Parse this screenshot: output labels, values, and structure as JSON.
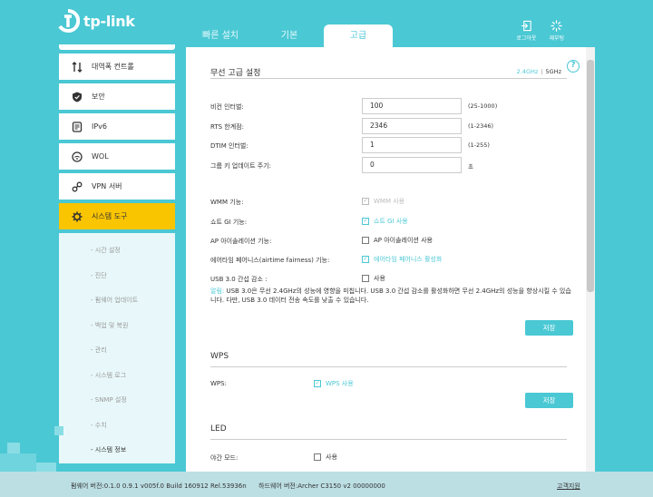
{
  "brand": {
    "name": "tp-link"
  },
  "tabs": [
    {
      "label": "빠른 설치"
    },
    {
      "label": "기본"
    },
    {
      "label": "고급"
    }
  ],
  "top_actions": {
    "logout": "로그아웃",
    "reboot": "재부팅"
  },
  "sidebar": {
    "items": [
      {
        "label": "대역폭 컨트롤",
        "icon": "bandwidth-icon"
      },
      {
        "label": "보안",
        "icon": "shield-icon"
      },
      {
        "label": "IPv6",
        "icon": "ipv6-icon"
      },
      {
        "label": "WOL",
        "icon": "wol-icon"
      },
      {
        "label": "VPN 서버",
        "icon": "vpn-icon"
      },
      {
        "label": "시스템 도구",
        "icon": "gear-icon"
      }
    ],
    "sub_items": [
      {
        "label": "- 시간 설정"
      },
      {
        "label": "- 진단"
      },
      {
        "label": "- 펌웨어 업데이트"
      },
      {
        "label": "- 백업 및 복원"
      },
      {
        "label": "- 관리"
      },
      {
        "label": "- 시스템 로그"
      },
      {
        "label": "- SNMP 설정"
      },
      {
        "label": "- 수치"
      },
      {
        "label": "- 시스템 정보"
      }
    ]
  },
  "wireless": {
    "title": "무선 고급 설정",
    "band_24": "2.4GHz",
    "band_5": "5GHz",
    "beacon": {
      "label": "비컨 인터벌:",
      "value": "100",
      "range": "(25-1000)"
    },
    "rts": {
      "label": "RTS 한계점:",
      "value": "2346",
      "range": "(1-2346)"
    },
    "dtim": {
      "label": "DTIM 인터벌:",
      "value": "1",
      "range": "(1-255)"
    },
    "group_key": {
      "label": "그룹 키 업데이트 주기:",
      "value": "0",
      "unit": "초"
    },
    "wmm": {
      "label": "WMM 기능:",
      "option": "WMM 사용",
      "checked": true,
      "disabled": true
    },
    "short_gi": {
      "label": "쇼트 GI 기능:",
      "option": "쇼트 GI 사용",
      "checked": true
    },
    "ap_isolation": {
      "label": "AP 아이솔레이션 기능:",
      "option": "AP 아이솔레이션 사용",
      "checked": false
    },
    "airtime": {
      "label": "에어타임 페어니스(airtime fairness) 기능:",
      "option": "에어타임 페어니스 활성화",
      "checked": true
    },
    "usb3": {
      "label": "USB 3.0 간섭 감소 :",
      "option": "사용",
      "checked": false
    },
    "note_prefix": "알림:",
    "note_text": " USB 3.0은 무선 2.4GHz의 성능에 영향을 미칩니다. USB 3.0 간섭 감소를 활성화하면 무선 2.4GHz의 성능을 향상시킬 수 있습니다. 다만, USB 3.0 데이터 전송 속도를 낮출 수 있습니다.",
    "save": "저장"
  },
  "wps": {
    "title": "WPS",
    "label": "WPS:",
    "option": "WPS 사용",
    "checked": true,
    "save": "저장"
  },
  "led": {
    "title": "LED",
    "label": "야간 모드:",
    "option": "사용",
    "checked": false
  },
  "footer": {
    "firmware": "펌웨어 버전:0.1.0 0.9.1 v005f.0 Build 160912 Rel.53936n",
    "hardware": "하드웨어 버전:Archer C3150 v2 00000000",
    "support": "고객지원"
  },
  "colors": {
    "accent": "#4ac8d4",
    "active_menu": "#f9c400"
  }
}
